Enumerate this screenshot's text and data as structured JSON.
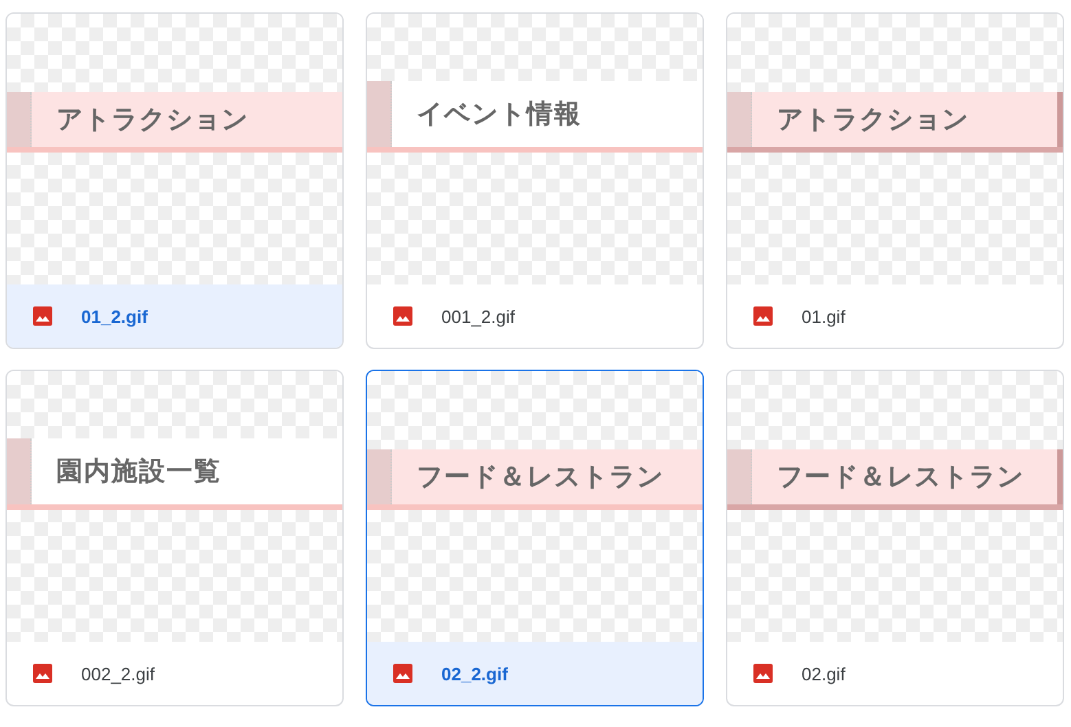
{
  "files": [
    {
      "name": "01_2.gif",
      "selected": true,
      "focused": false,
      "banner": {
        "text": "アトラクション",
        "kind": "pink"
      }
    },
    {
      "name": "001_2.gif",
      "selected": false,
      "focused": false,
      "banner": {
        "text": "イベント情報",
        "kind": "white"
      }
    },
    {
      "name": "01.gif",
      "selected": false,
      "focused": false,
      "banner": {
        "text": "アトラクション",
        "kind": "shadow"
      }
    },
    {
      "name": "002_2.gif",
      "selected": false,
      "focused": false,
      "banner": {
        "text": "園内施設一覧",
        "kind": "white"
      }
    },
    {
      "name": "02_2.gif",
      "selected": true,
      "focused": true,
      "banner": {
        "text": "フード＆レストラン",
        "kind": "pink"
      }
    },
    {
      "name": "02.gif",
      "selected": false,
      "focused": false,
      "banner": {
        "text": "フード＆レストラン",
        "kind": "shadow"
      }
    }
  ]
}
